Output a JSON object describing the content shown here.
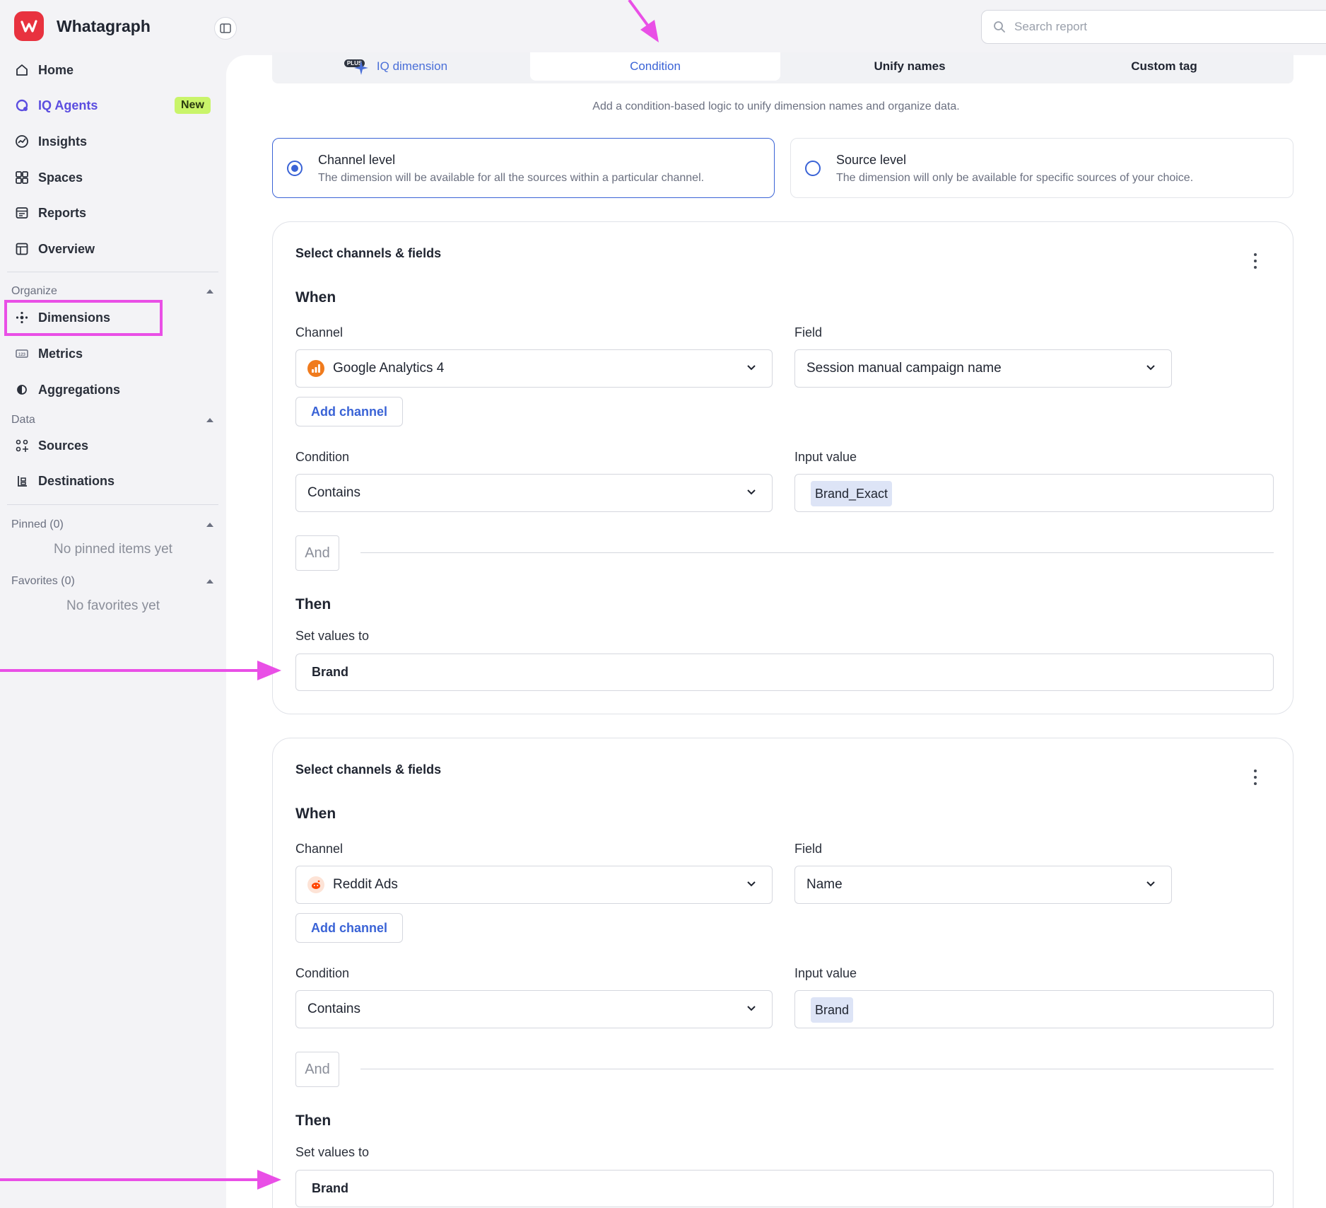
{
  "app": {
    "name": "Whatagraph"
  },
  "sidebar": {
    "nav": [
      {
        "label": "Home"
      },
      {
        "label": "IQ Agents",
        "badge": "New"
      },
      {
        "label": "Insights"
      },
      {
        "label": "Spaces"
      },
      {
        "label": "Reports"
      },
      {
        "label": "Overview"
      }
    ],
    "organize": {
      "title": "Organize",
      "items": [
        {
          "label": "Dimensions"
        },
        {
          "label": "Metrics"
        },
        {
          "label": "Aggregations"
        }
      ]
    },
    "data": {
      "title": "Data",
      "items": [
        {
          "label": "Sources"
        },
        {
          "label": "Destinations"
        }
      ]
    },
    "pinned": {
      "title": "Pinned (0)",
      "empty": "No pinned items yet"
    },
    "favorites": {
      "title": "Favorites (0)",
      "empty": "No favorites yet"
    }
  },
  "search": {
    "placeholder": "Search report"
  },
  "tabs": [
    {
      "label": "IQ dimension",
      "badge": "PLUS"
    },
    {
      "label": "Condition",
      "active": true
    },
    {
      "label": "Unify names"
    },
    {
      "label": "Custom tag"
    }
  ],
  "subtitle": "Add a condition-based logic to unify dimension names and organize data.",
  "levels": [
    {
      "title": "Channel level",
      "desc": "The dimension will be available for all the sources within a particular channel.",
      "selected": true
    },
    {
      "title": "Source level",
      "desc": "The dimension will only be available for specific sources of your choice.",
      "selected": false
    }
  ],
  "labels": {
    "card_title": "Select channels & fields",
    "when": "When",
    "channel": "Channel",
    "field": "Field",
    "add_channel": "Add channel",
    "condition": "Condition",
    "input_value": "Input value",
    "and": "And",
    "then": "Then",
    "set_values_to": "Set values to"
  },
  "conditions": [
    {
      "channel": "Google Analytics 4",
      "channel_icon": "google-analytics-icon",
      "field": "Session manual campaign name",
      "condition": "Contains",
      "input_value": "Brand_Exact",
      "set_value": "Brand"
    },
    {
      "channel": "Reddit Ads",
      "channel_icon": "reddit-icon",
      "field": "Name",
      "condition": "Contains",
      "input_value": "Brand",
      "set_value": "Brand"
    }
  ],
  "colors": {
    "accent": "#3a63d6",
    "annotation": "#e94fe6",
    "brand": "#e8323f",
    "new_badge": "#c9f46a"
  }
}
